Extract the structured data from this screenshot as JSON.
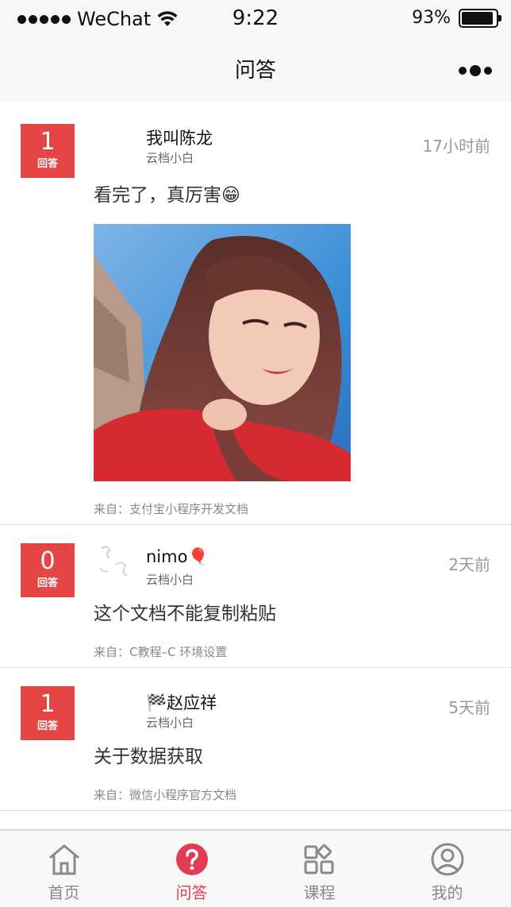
{
  "status_bar": {
    "carrier": "WeChat",
    "time": "9:22",
    "battery": "93%",
    "battery_level": 0.93
  },
  "nav": {
    "title": "问答"
  },
  "feed": [
    {
      "answers": "1",
      "answers_label": "回答",
      "username": "我叫陈龙",
      "role": "云档小白",
      "time": "17小时前",
      "title": "看完了，真厉害😁",
      "has_image": true,
      "source": "来自：支付宝小程序开发文档"
    },
    {
      "answers": "0",
      "answers_label": "回答",
      "username": "nimo🎈",
      "role": "云档小白",
      "time": "2天前",
      "title": "这个文档不能复制粘贴",
      "has_image": false,
      "source": "来自：C教程–C 环境设置"
    },
    {
      "answers": "1",
      "answers_label": "回答",
      "username": "🏁赵应祥",
      "role": "云档小白",
      "time": "5天前",
      "title": "关于数据获取",
      "has_image": false,
      "source": "来自：微信小程序官方文档"
    }
  ],
  "tabs": [
    {
      "label": "首页",
      "icon": "home-icon",
      "active": false
    },
    {
      "label": "问答",
      "icon": "question-icon",
      "active": true
    },
    {
      "label": "课程",
      "icon": "grid-icon",
      "active": false
    },
    {
      "label": "我的",
      "icon": "profile-icon",
      "active": false
    }
  ],
  "colors": {
    "badge": "#e54545",
    "active_tab": "#e23b55",
    "inactive_tab": "#888888"
  }
}
